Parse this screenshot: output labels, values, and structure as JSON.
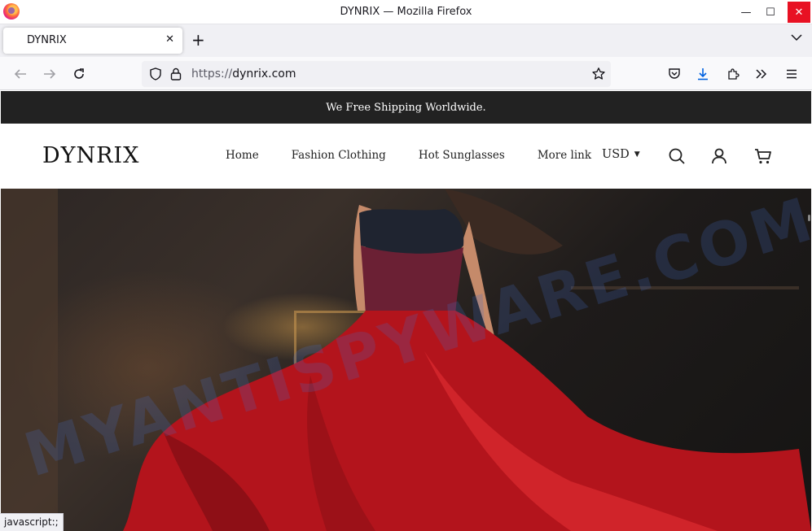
{
  "window": {
    "title": "DYNRIX — Mozilla Firefox",
    "minimize": "—",
    "maximize": "☐",
    "close": "✕"
  },
  "tabs": [
    {
      "label": "DYNRIX",
      "close": "✕"
    }
  ],
  "tab_controls": {
    "new_tab": "+",
    "list_all": "⌵"
  },
  "address_bar": {
    "scheme": "https://",
    "host": "dynrix.com"
  },
  "site": {
    "announcement": "We Free Shipping Worldwide.",
    "logo": "DYNRIX",
    "menu": [
      "Home",
      "Fashion Clothing",
      "Hot Sunglasses",
      "More link"
    ],
    "currency": "USD",
    "currency_caret": "▼",
    "icons": [
      "search-icon",
      "account-icon",
      "cart-icon"
    ],
    "hero_alt": "woman in red dress"
  },
  "watermark": "MYANTISPYWARE.COM",
  "status_bar": "javascript:;",
  "colors": {
    "announcement_bg": "#222222",
    "close_button": "#e81123",
    "dress_red": "#b3141c"
  }
}
